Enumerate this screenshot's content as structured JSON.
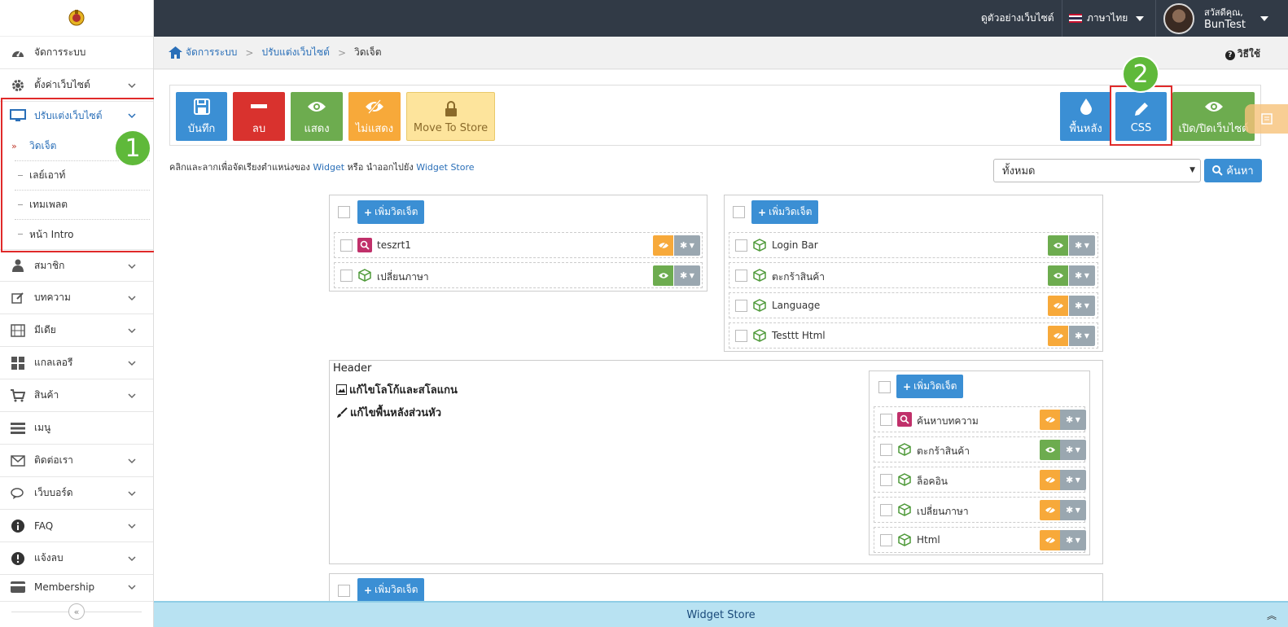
{
  "sidebar": {
    "items": [
      {
        "label": "จัดการระบบ",
        "icon": "dashboard-icon"
      },
      {
        "label": "ตั้งค่าเว็บไซต์",
        "icon": "gear-icon"
      },
      {
        "label": "ปรับแต่งเว็บไซต์",
        "icon": "monitor-icon"
      },
      {
        "label": "สมาชิก",
        "icon": "user-icon"
      },
      {
        "label": "บทความ",
        "icon": "edit-icon"
      },
      {
        "label": "มีเดีย",
        "icon": "film-icon"
      },
      {
        "label": "แกลเลอรี",
        "icon": "grid-icon"
      },
      {
        "label": "สินค้า",
        "icon": "cart-icon"
      },
      {
        "label": "เมนู",
        "icon": "menu-icon"
      },
      {
        "label": "ติดต่อเรา",
        "icon": "mail-icon"
      },
      {
        "label": "เว็บบอร์ด",
        "icon": "chat-icon"
      },
      {
        "label": "FAQ",
        "icon": "info-icon"
      },
      {
        "label": "แจ้งลบ",
        "icon": "alert-icon"
      },
      {
        "label": "Membership",
        "icon": "card-icon"
      }
    ],
    "sub_items": [
      "วิดเจ็ต",
      "เลย์เอาท์",
      "เทมเพลต",
      "หน้า Intro"
    ],
    "collapse": "«"
  },
  "annotations": {
    "badge1": "1",
    "badge2": "2"
  },
  "topbar": {
    "preview_link": "ดูตัวอย่างเว็บไซต์",
    "language": "ภาษาไทย",
    "greeting": "สวัสดีคุณ,",
    "username": "BunTest"
  },
  "breadcrumb": {
    "home": "จัดการระบบ",
    "parent": "ปรับแต่งเว็บไซต์",
    "current": "วิดเจ็ต"
  },
  "help": "วิธีใช้",
  "toolbar": {
    "save": "บันทึก",
    "delete": "ลบ",
    "show": "แสดง",
    "hide": "ไม่แสดง",
    "move": "Move To Store",
    "background": "พื้นหลัง",
    "css": "CSS",
    "toggle_site": "เปิด/ปิดเว็บไซต์"
  },
  "hint": {
    "p1": "คลิกและลากเพื่อจัดเรียงตำแหน่งของ ",
    "w1": "Widget",
    "p2": " หรือ นำออกไปยัง ",
    "w2": "Widget Store"
  },
  "filter": {
    "selected": "ทั้งหมด",
    "search": "ค้นหา"
  },
  "add_widget": "เพิ่มวิดเจ็ต",
  "panel_left": [
    {
      "label": "teszrt1",
      "icon": "search-icon",
      "visible": false
    },
    {
      "label": "เปลี่ยนภาษา",
      "icon": "cube-icon",
      "visible": true
    }
  ],
  "panel_right": [
    {
      "label": "Login Bar",
      "icon": "cube-icon",
      "visible": true
    },
    {
      "label": "ตะกร้าสินค้า",
      "icon": "cube-icon",
      "visible": true
    },
    {
      "label": "Language",
      "icon": "cube-icon",
      "visible": false
    },
    {
      "label": "Testtt Html",
      "icon": "cube-icon",
      "visible": false
    }
  ],
  "header_panel": {
    "title": "Header",
    "edit_logo": "แก้ไขโลโก้และสโลแกน",
    "edit_bg": "แก้ไขพื้นหลังส่วนหัว",
    "widgets": [
      {
        "label": "ค้นหาบทความ",
        "icon": "search-icon",
        "visible": false
      },
      {
        "label": "ตะกร้าสินค้า",
        "icon": "cube-icon",
        "visible": true
      },
      {
        "label": "ล็อคอิน",
        "icon": "cube-icon",
        "visible": false
      },
      {
        "label": "เปลี่ยนภาษา",
        "icon": "cube-icon",
        "visible": false
      },
      {
        "label": "Html",
        "icon": "cube-icon",
        "visible": false
      }
    ]
  },
  "widget_store": "Widget Store",
  "colors": {
    "primary": "#3b8fd4",
    "danger": "#d9322e",
    "success": "#6dac4f",
    "warning": "#f7a93a",
    "move": "#fde49c",
    "annotation_red": "#e02a2a",
    "annotation_green": "#5fb93a",
    "topbar": "#313a46"
  }
}
